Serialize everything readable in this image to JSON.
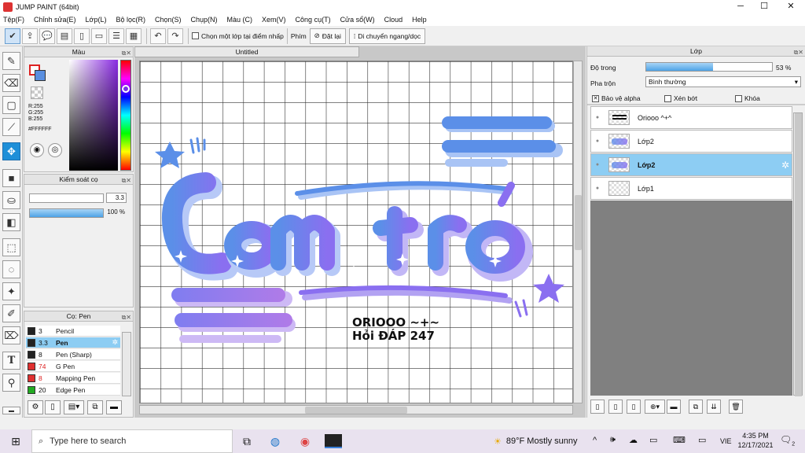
{
  "window": {
    "title": "JUMP PAINT (64bit)",
    "minimize": "─",
    "maximize": "☐",
    "close": "✕"
  },
  "menu": [
    "Tệp(F)",
    "Chỉnh sửa(E)",
    "Lớp(L)",
    "Bộ lọc(R)",
    "Chọn(S)",
    "Chụp(N)",
    "Màu (C)",
    "Xem(V)",
    "Công cụ(T)",
    "Cửa sổ(W)",
    "Cloud",
    "Help"
  ],
  "toolbar": {
    "select_one_layer": "Chọn một lớp tại điểm nhấp",
    "keys_label": "Phím",
    "reset": "Đặt lại",
    "move_hv": "Di chuyển ngang/dọc"
  },
  "color_panel": {
    "title": "Màu",
    "r": "R:255",
    "g": "G:255",
    "b": "B:255",
    "hex": "#FFFFFF"
  },
  "brush_control": {
    "title": "Kiểm soát cọ",
    "size": "3.3",
    "opacity": "100 %",
    "size_fraction": 0.9,
    "opacity_fraction": 1.0
  },
  "brush_panel": {
    "title": "Cọ: Pen",
    "items": [
      {
        "size": "3",
        "name": "Pencil",
        "color": "#222222",
        "selected": false
      },
      {
        "size": "3.3",
        "name": "Pen",
        "color": "#222222",
        "selected": true
      },
      {
        "size": "8",
        "name": "Pen (Sharp)",
        "color": "#222222",
        "selected": false
      },
      {
        "size": "74",
        "name": "G Pen",
        "color": "#e03030",
        "selected": false
      },
      {
        "size": "8",
        "name": "Mapping Pen",
        "color": "#e03030",
        "selected": false
      },
      {
        "size": "20",
        "name": "Edge Pen",
        "color": "#22aa22",
        "selected": false
      }
    ]
  },
  "document": {
    "tab": "Untitled",
    "art_line1": "ORIOOO ~+~",
    "art_line2": "Hỏi ĐÁP 247"
  },
  "layer_panel": {
    "title": "Lớp",
    "opacity_label": "Độ trong",
    "opacity_value": "53 %",
    "opacity_fraction": 0.53,
    "blend_label": "Pha trộn",
    "blend_value": "Bình thường",
    "protect_alpha": "Bảo vệ alpha",
    "clipping": "Xén bớt",
    "lock": "Khóa",
    "layers": [
      {
        "name": "Oriooo ^+^",
        "selected": false
      },
      {
        "name": "Lớp2",
        "selected": false
      },
      {
        "name": "Lớp2",
        "selected": true
      },
      {
        "name": "Lớp1",
        "selected": false
      }
    ]
  },
  "taskbar": {
    "search_placeholder": "Type here to search",
    "weather": "89°F  Mostly sunny",
    "lang": "VIE",
    "time": "4:35 PM",
    "date": "12/17/2021",
    "notif": "2"
  },
  "colors": {
    "accent": "#1e8fd8",
    "selection": "#8dcdf3",
    "art_blue": "#5b8fe8",
    "art_purple": "#8a6ff0"
  }
}
